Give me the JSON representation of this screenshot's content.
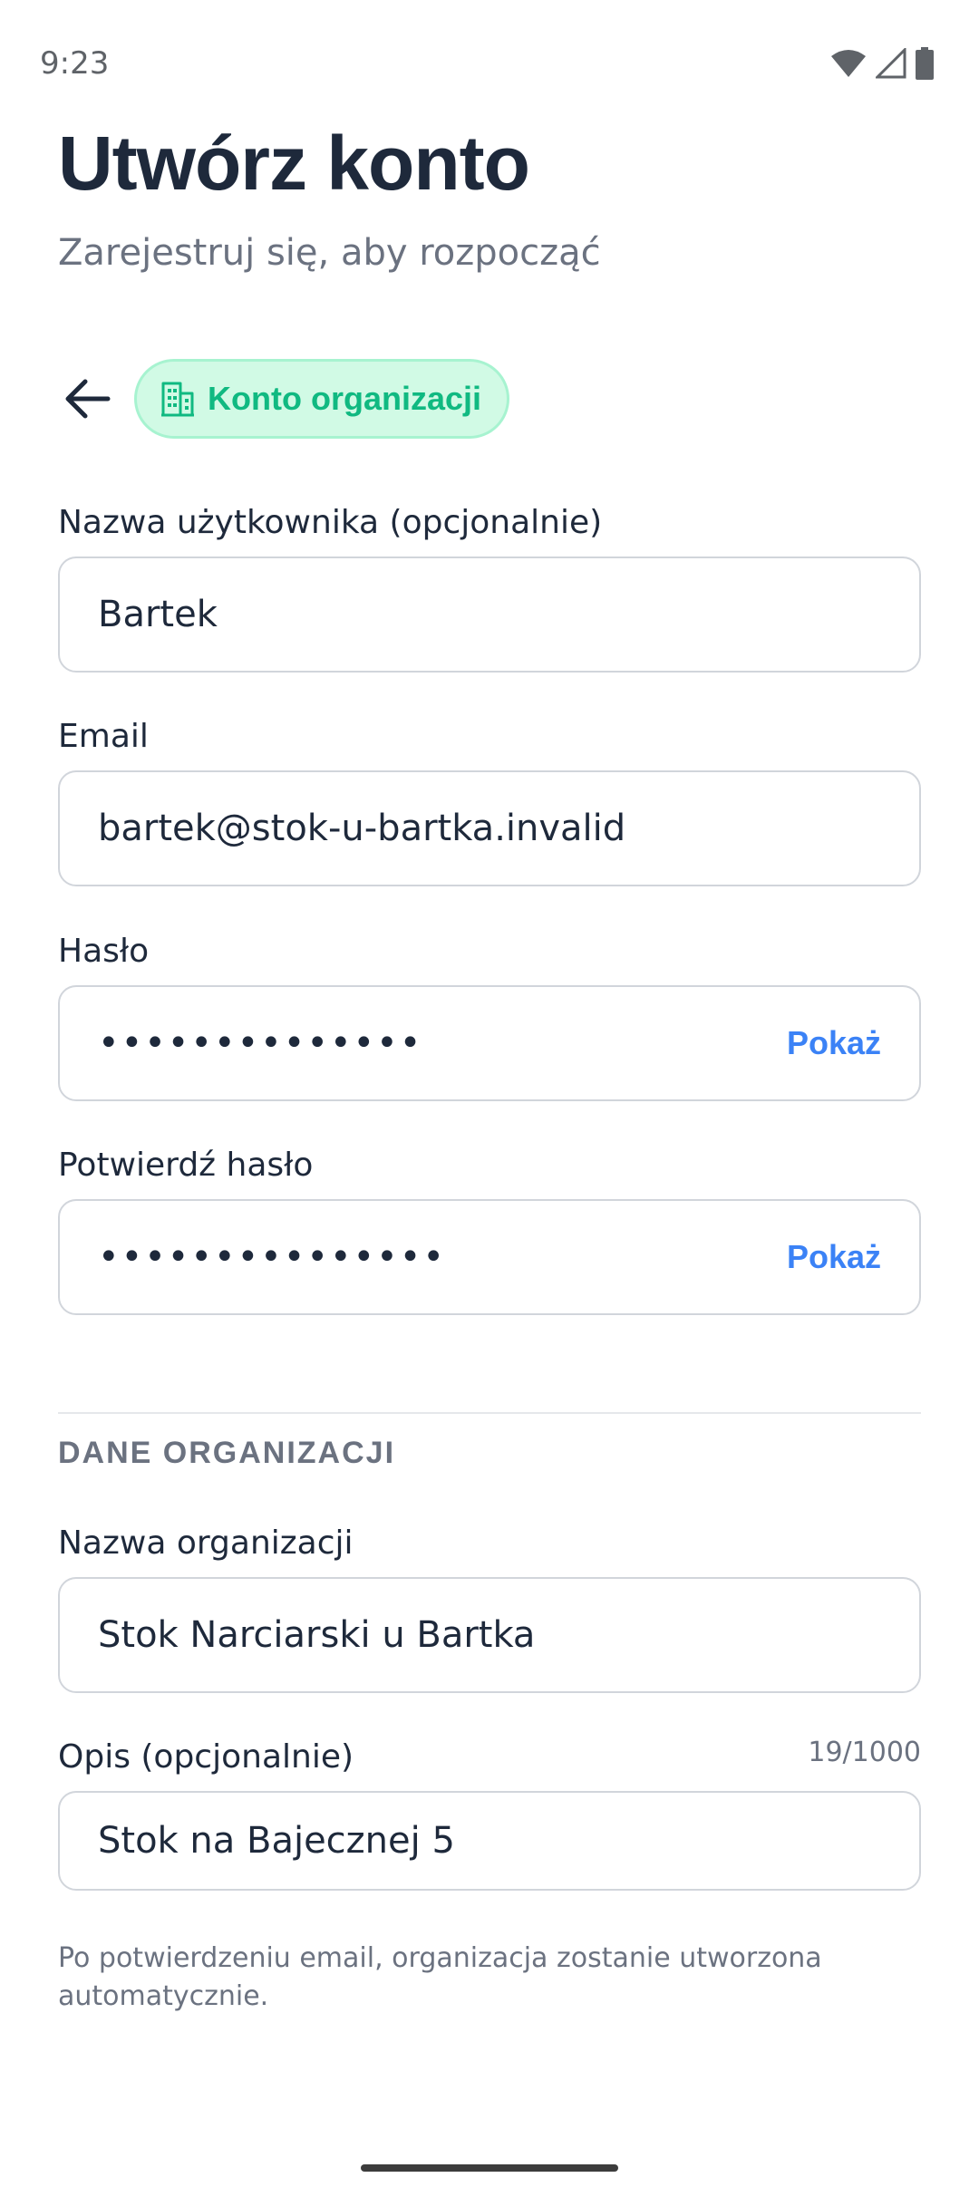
{
  "status_bar": {
    "time": "9:23",
    "icons": [
      "wifi-icon",
      "cell-signal-icon",
      "battery-icon"
    ]
  },
  "header": {
    "title": "Utwórz konto",
    "subtitle": "Zarejestruj się, aby rozpocząć"
  },
  "account_type": {
    "back_icon": "arrow-left-icon",
    "chip_icon": "building-icon",
    "chip_label": "Konto organizacji"
  },
  "form": {
    "username": {
      "label": "Nazwa użytkownika (opcjonalnie)",
      "value": "Bartek"
    },
    "email": {
      "label": "Email",
      "value": "bartek@stok-u-bartka.invalid"
    },
    "password": {
      "label": "Hasło",
      "masked_value": "••••••••••••••",
      "toggle_label": "Pokaż"
    },
    "confirm_password": {
      "label": "Potwierdź hasło",
      "masked_value": "•••••••••••••••",
      "toggle_label": "Pokaż"
    }
  },
  "organization": {
    "section_heading": "DANE ORGANIZACJI",
    "name": {
      "label": "Nazwa organizacji",
      "value": "Stok Narciarski u Bartka"
    },
    "description": {
      "label": "Opis (opcjonalnie)",
      "counter": "19/1000",
      "value": "Stok na Bajecznej 5"
    },
    "note": "Po potwierdzeniu email, organizacja zostanie utworzona automatycznie."
  },
  "colors": {
    "accent_green": "#10b981",
    "chip_background": "#d1fae5",
    "link_blue": "#3b82f6",
    "title_text": "#1e293b",
    "muted_text": "#6b7280",
    "border": "#d1d5db"
  }
}
